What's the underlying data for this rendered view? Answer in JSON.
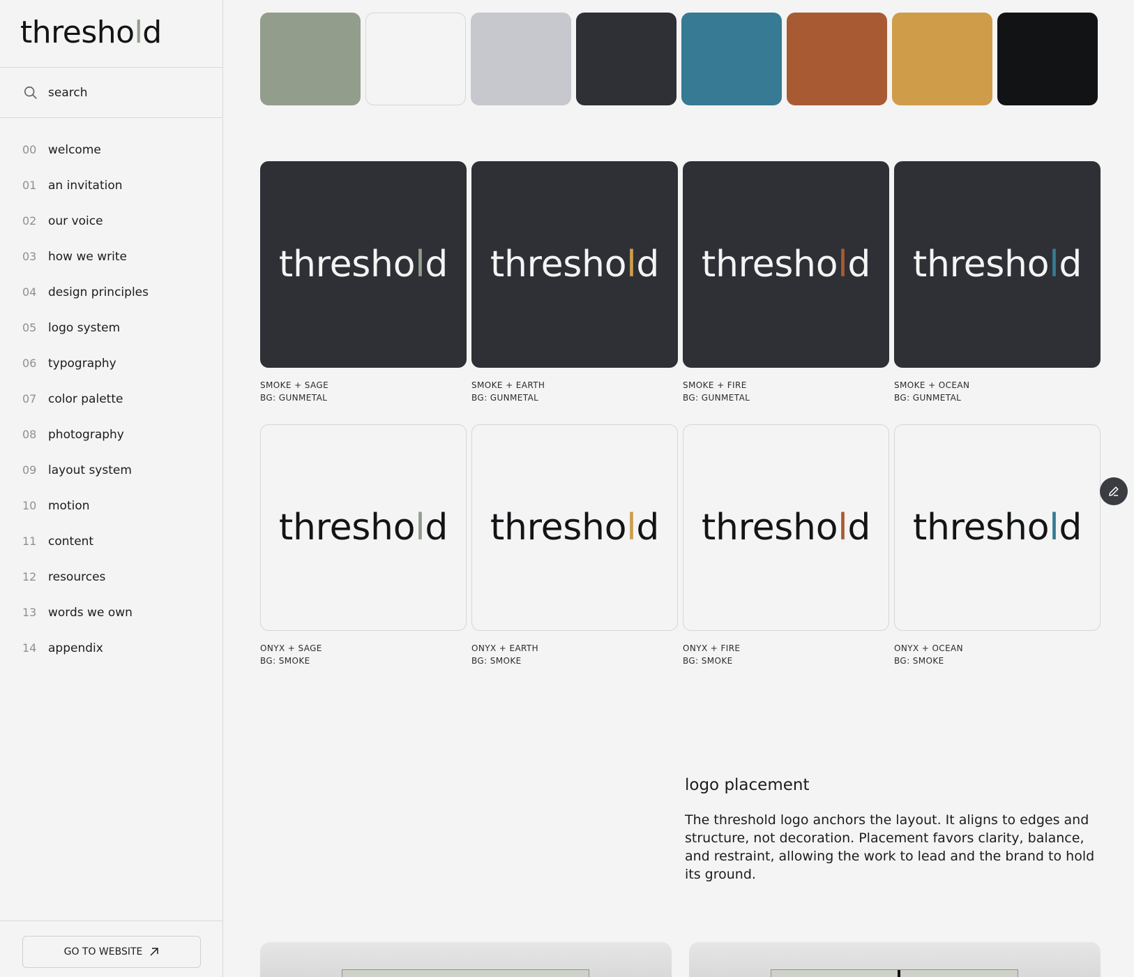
{
  "brand": {
    "prefix": "thresho",
    "accent": "l",
    "suffix": "d",
    "accent_color": "#929d8b"
  },
  "search": {
    "placeholder": "search"
  },
  "nav": [
    {
      "num": "00",
      "label": "welcome"
    },
    {
      "num": "01",
      "label": "an invitation"
    },
    {
      "num": "02",
      "label": "our voice"
    },
    {
      "num": "03",
      "label": "how we write"
    },
    {
      "num": "04",
      "label": "design principles"
    },
    {
      "num": "05",
      "label": "logo system"
    },
    {
      "num": "06",
      "label": "typography"
    },
    {
      "num": "07",
      "label": "color palette"
    },
    {
      "num": "08",
      "label": "photography"
    },
    {
      "num": "09",
      "label": "layout system"
    },
    {
      "num": "10",
      "label": "motion"
    },
    {
      "num": "11",
      "label": "content"
    },
    {
      "num": "12",
      "label": "resources"
    },
    {
      "num": "13",
      "label": "words we own"
    },
    {
      "num": "14",
      "label": "appendix"
    }
  ],
  "footer": {
    "button_label": "GO TO WEBSITE",
    "button_icon": "arrow-up-right-icon"
  },
  "swatches": [
    "#929d8b",
    "#f4f4f4",
    "#c6c8ce",
    "#2e3036",
    "#367a93",
    "#a85b33",
    "#cf9c4a",
    "#121314"
  ],
  "logo_word": {
    "prefix": "thresho",
    "accent": "l",
    "suffix": "d"
  },
  "dark_cards": [
    {
      "accent_color": "#929d8b",
      "caption1": "SMOKE + SAGE",
      "caption2": "BG: GUNMETAL"
    },
    {
      "accent_color": "#cf9c4a",
      "caption1": "SMOKE + EARTH",
      "caption2": "BG: GUNMETAL"
    },
    {
      "accent_color": "#a85b33",
      "caption1": "SMOKE + FIRE",
      "caption2": "BG: GUNMETAL"
    },
    {
      "accent_color": "#367a93",
      "caption1": "SMOKE + OCEAN",
      "caption2": "BG: GUNMETAL"
    }
  ],
  "light_cards": [
    {
      "accent_color": "#929d8b",
      "caption1": "ONYX + SAGE",
      "caption2": "BG: SMOKE"
    },
    {
      "accent_color": "#cf9c4a",
      "caption1": "ONYX + EARTH",
      "caption2": "BG: SMOKE"
    },
    {
      "accent_color": "#a85b33",
      "caption1": "ONYX + FIRE",
      "caption2": "BG: SMOKE"
    },
    {
      "accent_color": "#367a93",
      "caption1": "ONYX + OCEAN",
      "caption2": "BG: SMOKE"
    }
  ],
  "edit_button": {
    "icon": "pencil-icon"
  },
  "placement": {
    "title": "logo placement",
    "body": "The threshold logo anchors the layout. It aligns to edges and structure, not decoration. Placement favors clarity, balance, and restraint, allowing the work to lead and the brand to hold its ground."
  }
}
